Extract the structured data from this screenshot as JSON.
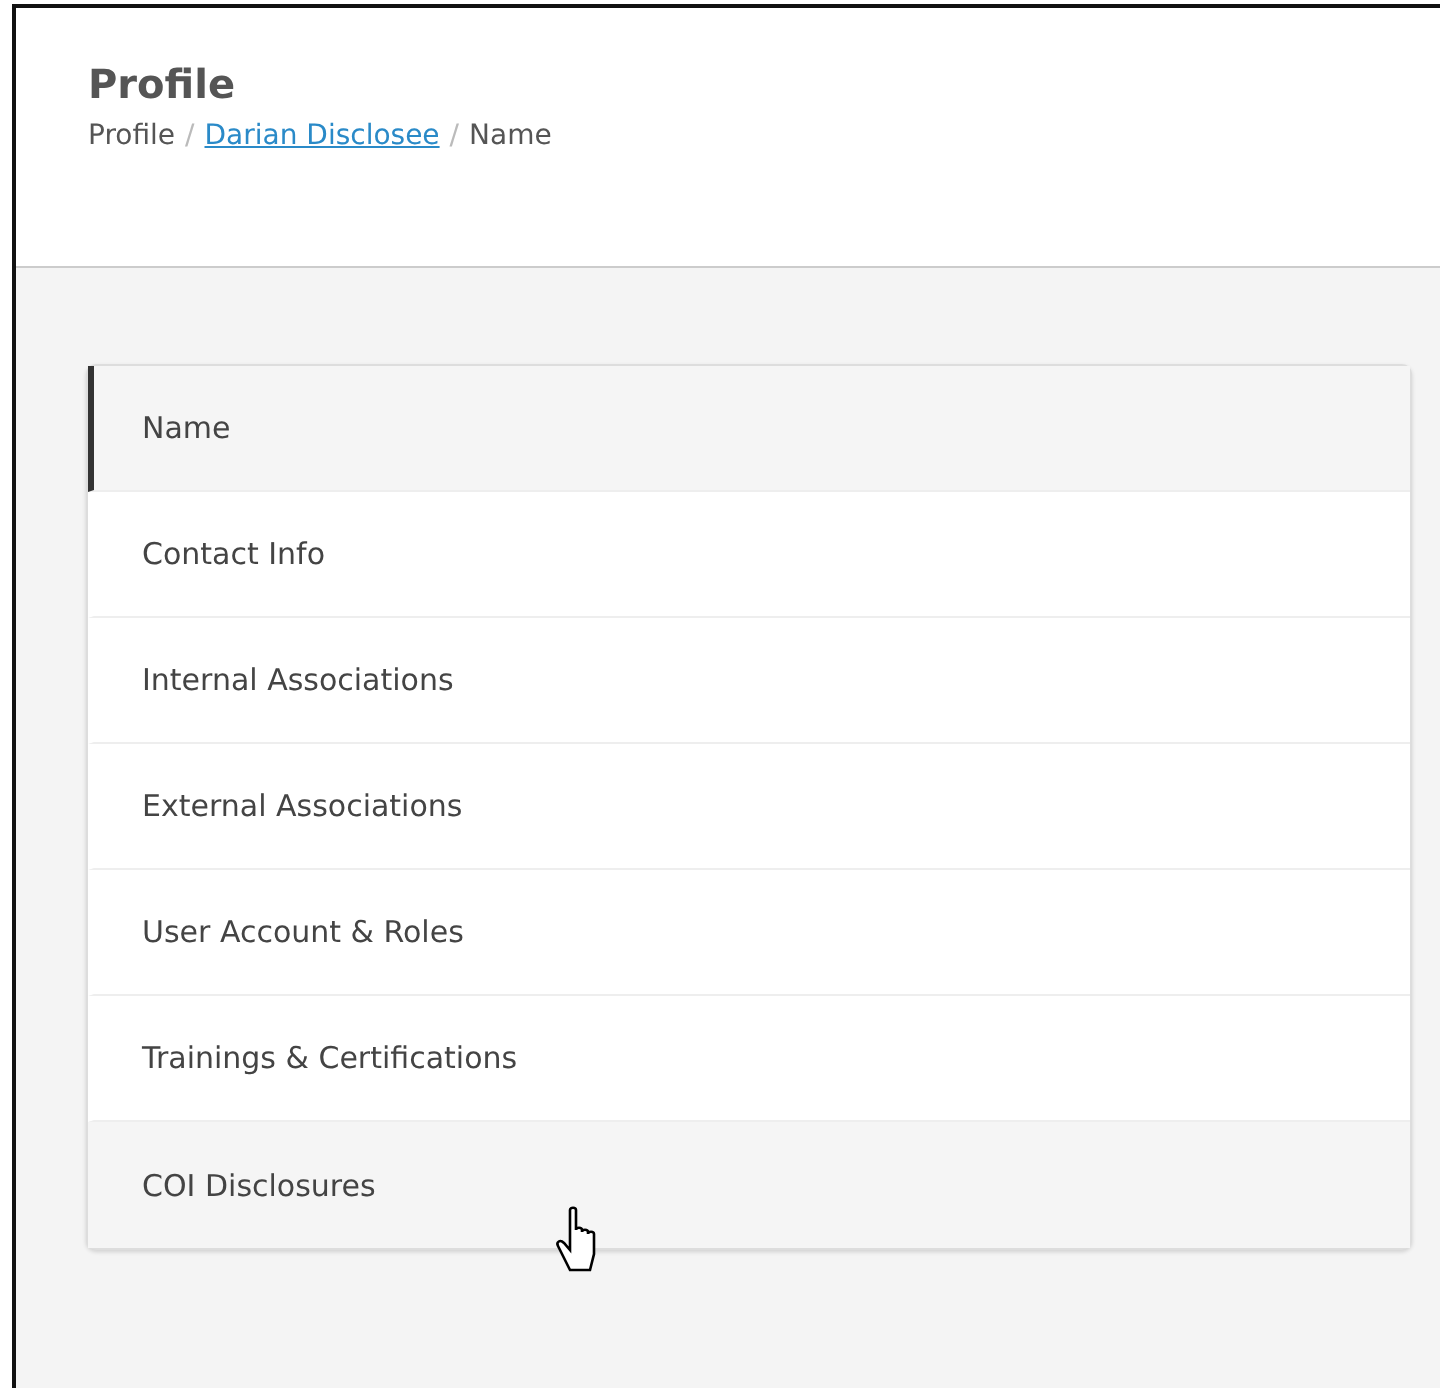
{
  "header": {
    "title": "Profile",
    "breadcrumb": [
      {
        "label": "Profile",
        "kind": "text"
      },
      {
        "label": "/",
        "kind": "separator"
      },
      {
        "label": "Darian Disclosee",
        "kind": "link"
      },
      {
        "label": "/",
        "kind": "separator"
      },
      {
        "label": "Name",
        "kind": "text"
      }
    ]
  },
  "menu": {
    "items": [
      {
        "label": "Name",
        "selected": true,
        "hovered": false
      },
      {
        "label": "Contact Info",
        "selected": false,
        "hovered": false
      },
      {
        "label": "Internal Associations",
        "selected": false,
        "hovered": false
      },
      {
        "label": "External Associations",
        "selected": false,
        "hovered": false
      },
      {
        "label": "User Account & Roles",
        "selected": false,
        "hovered": false
      },
      {
        "label": "Trainings & Certifications",
        "selected": false,
        "hovered": false
      },
      {
        "label": "COI Disclosures",
        "selected": false,
        "hovered": true
      }
    ]
  }
}
